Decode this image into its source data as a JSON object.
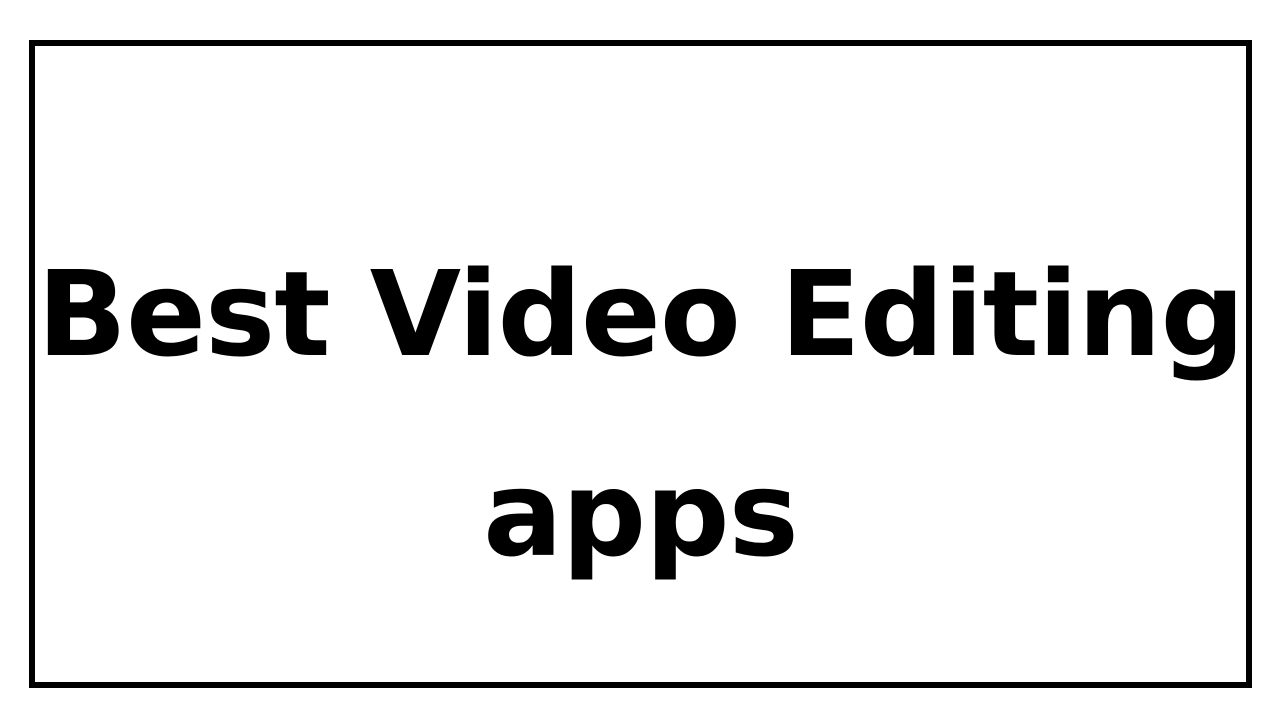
{
  "title": {
    "line1": "Best Video Editing",
    "line2": "apps"
  },
  "colors": {
    "background": "#ffffff",
    "border": "#000000",
    "text": "#000000"
  }
}
